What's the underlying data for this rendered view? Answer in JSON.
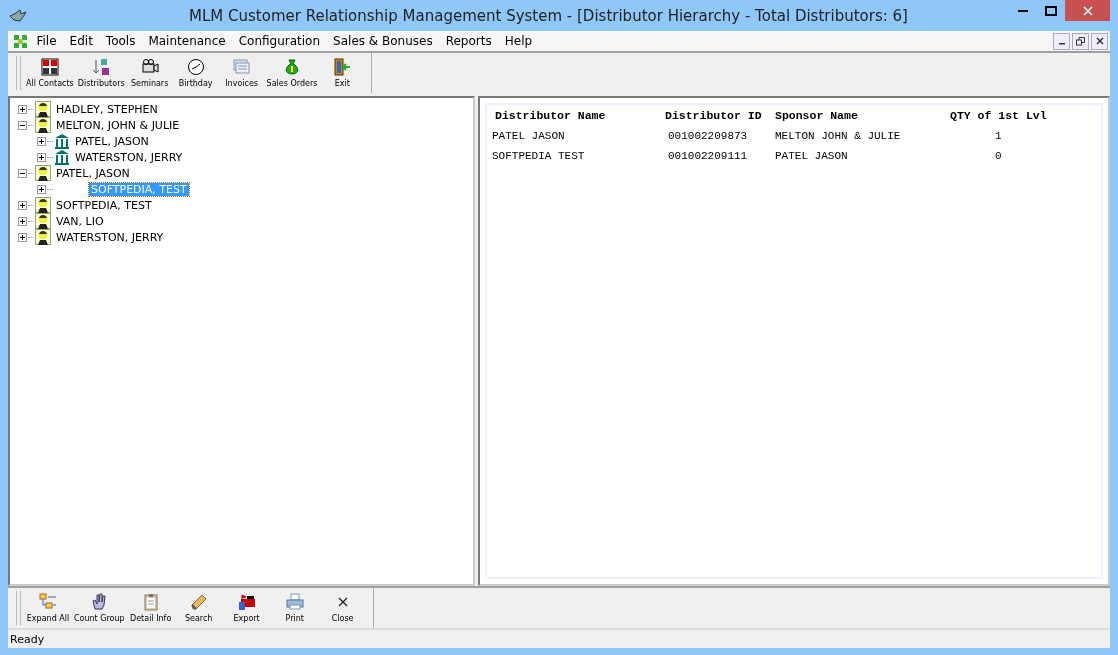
{
  "window": {
    "title": "MLM Customer Relationship Management System - [Distributor Hierarchy - Total Distributors: 6]"
  },
  "menu": [
    "File",
    "Edit",
    "Tools",
    "Maintenance",
    "Configuration",
    "Sales & Bonuses",
    "Reports",
    "Help"
  ],
  "toolbar": [
    {
      "label": "All Contacts",
      "kind": "contacts"
    },
    {
      "label": "Distributors",
      "kind": "sort"
    },
    {
      "label": "Seminars",
      "kind": "camera"
    },
    {
      "label": "Birthday",
      "kind": "clock"
    },
    {
      "label": "Invoices",
      "kind": "invoices"
    },
    {
      "label": "Sales Orders",
      "kind": "money"
    },
    {
      "label": "Exit",
      "kind": "exit"
    }
  ],
  "tree": [
    {
      "label": "HADLEY, STEPHEN",
      "kind": "person",
      "expanded": false,
      "selected": false
    },
    {
      "label": "MELTON, JOHN & JULIE",
      "kind": "person",
      "expanded": true,
      "selected": false,
      "children": [
        {
          "label": "PATEL, JASON",
          "kind": "building",
          "expanded": false,
          "selected": false
        },
        {
          "label": "WATERSTON, JERRY",
          "kind": "building",
          "expanded": false,
          "selected": false
        }
      ]
    },
    {
      "label": "PATEL, JASON",
      "kind": "person",
      "expanded": true,
      "selected": false,
      "children": [
        {
          "label": "SOFTPEDIA, TEST",
          "kind": "none",
          "expanded": false,
          "selected": true
        }
      ]
    },
    {
      "label": "SOFTPEDIA, TEST",
      "kind": "person",
      "expanded": false,
      "selected": false
    },
    {
      "label": "VAN, LIO",
      "kind": "person",
      "expanded": false,
      "selected": false
    },
    {
      "label": "WATERSTON, JERRY",
      "kind": "person",
      "expanded": false,
      "selected": false
    }
  ],
  "table": {
    "columns": [
      "Distributor Name",
      "Distributor ID",
      "Sponsor Name",
      "QTY of 1st Lvl"
    ],
    "rows": [
      [
        "PATEL JASON",
        "001002209873",
        "MELTON JOHN & JULIE",
        "1"
      ],
      [
        "SOFTPEDIA TEST",
        "001002209111",
        "PATEL JASON",
        "0"
      ]
    ]
  },
  "bottom_toolbar": [
    {
      "label": "Expand All",
      "kind": "expand"
    },
    {
      "label": "Count Group",
      "kind": "hand"
    },
    {
      "label": "Detail Info",
      "kind": "clipboard"
    },
    {
      "label": "Search",
      "kind": "pencil"
    },
    {
      "label": "Export",
      "kind": "export"
    },
    {
      "label": "Print",
      "kind": "printer"
    },
    {
      "label": "Close",
      "kind": "close"
    }
  ],
  "status_bar": "Ready"
}
